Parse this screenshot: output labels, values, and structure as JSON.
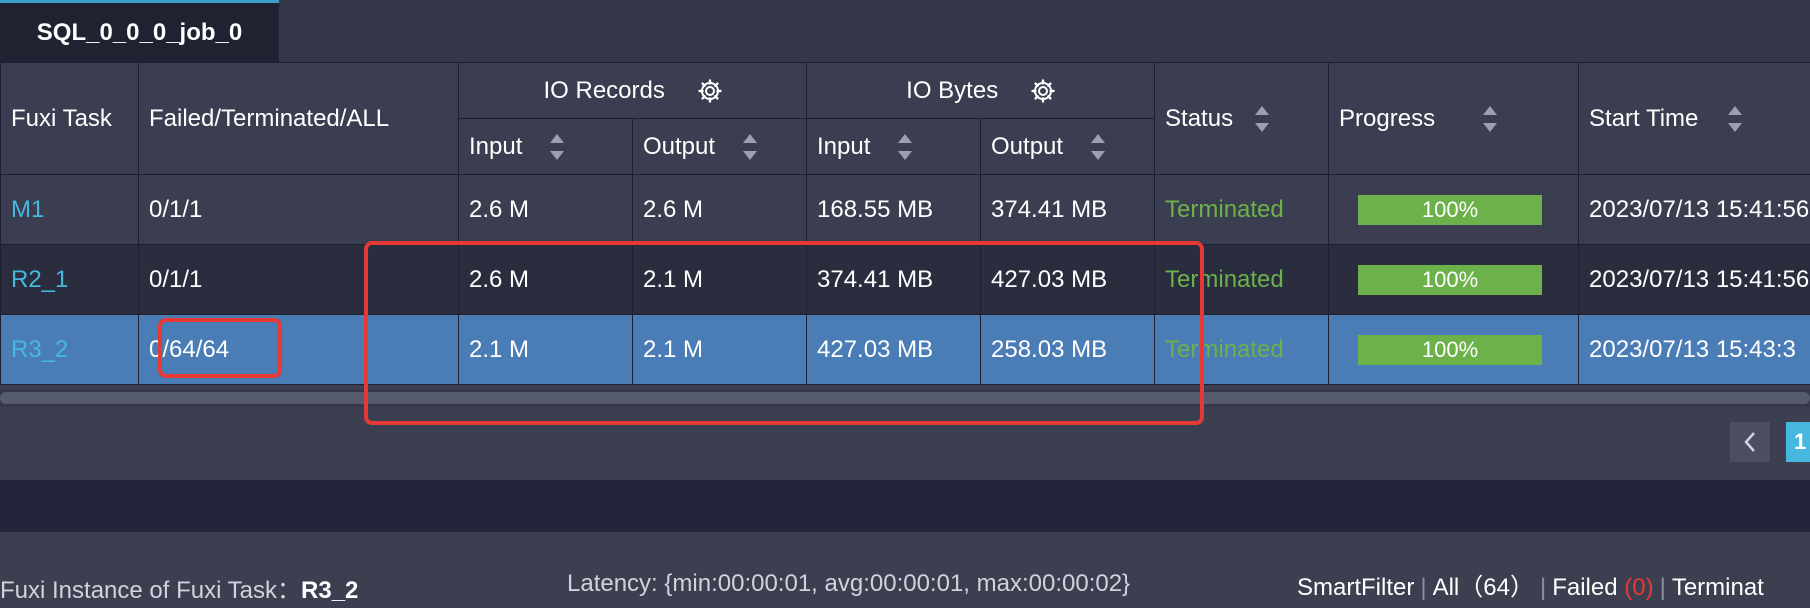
{
  "tab": {
    "label": "SQL_0_0_0_job_0"
  },
  "table": {
    "headers": {
      "fuxi_task": "Fuxi Task",
      "failed_terminated_all": "Failed/Terminated/ALL",
      "io_records": "IO Records",
      "io_bytes": "IO Bytes",
      "input": "Input",
      "output": "Output",
      "status": "Status",
      "progress": "Progress",
      "start_time": "Start Time"
    },
    "rows": [
      {
        "task": "M1",
        "counts": "0/1/1",
        "rec_in": "2.6 M",
        "rec_out": "2.6 M",
        "bytes_in": "168.55 MB",
        "bytes_out": "374.41 MB",
        "status": "Terminated",
        "progress": "100%",
        "progress_value": 100,
        "start_time": "2023/07/13 15:41:56"
      },
      {
        "task": "R2_1",
        "counts": "0/1/1",
        "rec_in": "2.6 M",
        "rec_out": "2.1 M",
        "bytes_in": "374.41 MB",
        "bytes_out": "427.03 MB",
        "status": "Terminated",
        "progress": "100%",
        "progress_value": 100,
        "start_time": "2023/07/13 15:41:56"
      },
      {
        "task": "R3_2",
        "counts": "0/64/64",
        "rec_in": "2.1 M",
        "rec_out": "2.1 M",
        "bytes_in": "427.03 MB",
        "bytes_out": "258.03 MB",
        "status": "Terminated",
        "progress": "100%",
        "progress_value": 100,
        "start_time": "2023/07/13 15:43:3"
      }
    ]
  },
  "pagination": {
    "current_page": "1"
  },
  "footer": {
    "title_prefix": "Fuxi Instance of Fuxi Task：",
    "task_name": "R3_2",
    "latency": "Latency: {min:00:00:01, avg:00:00:01, max:00:00:02}",
    "smartfilter": "SmartFilter",
    "all_label": "All",
    "all_count": "（64）",
    "failed_label": "Failed",
    "failed_count": "(0)",
    "terminated_label": "Terminat"
  },
  "colors": {
    "accent": "#46b8e0",
    "selected_row": "#4a7cb6",
    "status_green": "#6cb14a",
    "highlight_red": "#e53935"
  },
  "icons": [
    "gear-icon",
    "sort-icon",
    "chevron-left-icon"
  ]
}
